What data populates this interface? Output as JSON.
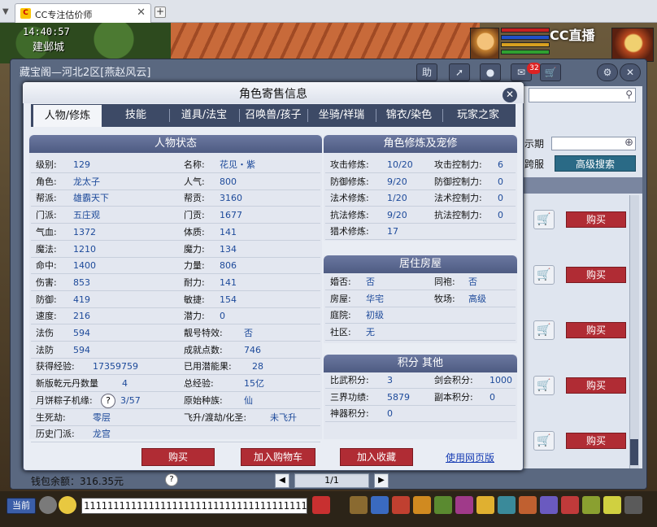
{
  "browser": {
    "tab_title": "CC专注估价师"
  },
  "game": {
    "clock": "14:40:57",
    "city": "建邺城",
    "logo": "CC直播",
    "chat_badge": "32"
  },
  "outer": {
    "title": "藏宝阁—河北2区[燕赵风云]",
    "expire_label": "示期",
    "cross_label": "跨服",
    "advanced_search": "高级搜索",
    "buy_label": "购买",
    "wallet": "钱包余额：316.35元",
    "page": "1/1"
  },
  "modal": {
    "title": "角色寄售信息",
    "tabs": [
      {
        "label": "人物/修炼"
      },
      {
        "label": "技能"
      },
      {
        "label": "道具/法宝"
      },
      {
        "label": "召唤兽/孩子"
      },
      {
        "label": "坐骑/祥瑞"
      },
      {
        "label": "锦衣/染色"
      },
      {
        "label": "玩家之家"
      }
    ],
    "status_title": "人物状态",
    "status_left": [
      {
        "k": "级别:",
        "v": "129"
      },
      {
        "k": "角色:",
        "v": "龙太子"
      },
      {
        "k": "帮派:",
        "v": "雄霸天下"
      },
      {
        "k": "门派:",
        "v": "五庄观"
      },
      {
        "k": "气血:",
        "v": "1372"
      },
      {
        "k": "魔法:",
        "v": "1210"
      },
      {
        "k": "命中:",
        "v": "1400"
      },
      {
        "k": "伤害:",
        "v": "853"
      },
      {
        "k": "防御:",
        "v": "419"
      },
      {
        "k": "速度:",
        "v": "216"
      },
      {
        "k": "法伤",
        "v": "594"
      },
      {
        "k": "法防",
        "v": "594"
      },
      {
        "k": "获得经验:",
        "v": "17359759"
      },
      {
        "k": "新版乾元丹数量",
        "v": "4"
      },
      {
        "k": "月饼粽子机缘:",
        "v": "3/57"
      },
      {
        "k": "生死劫:",
        "v": "零层"
      },
      {
        "k": "历史门派:",
        "v": "龙宫"
      }
    ],
    "status_right": [
      {
        "k": "名称:",
        "v": "花见・紫"
      },
      {
        "k": "人气:",
        "v": "800"
      },
      {
        "k": "帮贡:",
        "v": "3160"
      },
      {
        "k": "门贡:",
        "v": "1677"
      },
      {
        "k": "体质:",
        "v": "141"
      },
      {
        "k": "魔力:",
        "v": "134"
      },
      {
        "k": "力量:",
        "v": "806"
      },
      {
        "k": "耐力:",
        "v": "141"
      },
      {
        "k": "敏捷:",
        "v": "154"
      },
      {
        "k": "潜力:",
        "v": "0"
      },
      {
        "k": "靓号特效:",
        "v": "否"
      },
      {
        "k": "成就点数:",
        "v": "746"
      },
      {
        "k": "已用潜能果:",
        "v": "28"
      },
      {
        "k": "总经验:",
        "v": "15亿"
      },
      {
        "k": "原始种族:",
        "v": "仙"
      },
      {
        "k": "飞升/渡劫/化圣:",
        "v": "未飞升"
      }
    ],
    "cultivation_title": "角色修炼及宠修",
    "cultivation": [
      {
        "k1": "攻击修炼:",
        "v1": "10/20",
        "k2": "攻击控制力:",
        "v2": "6"
      },
      {
        "k1": "防御修炼:",
        "v1": "9/20",
        "k2": "防御控制力:",
        "v2": "0"
      },
      {
        "k1": "法术修炼:",
        "v1": "1/20",
        "k2": "法术控制力:",
        "v2": "0"
      },
      {
        "k1": "抗法修炼:",
        "v1": "9/20",
        "k2": "抗法控制力:",
        "v2": "0"
      },
      {
        "k1": "猎术修炼:",
        "v1": "17",
        "k2": "",
        "v2": ""
      }
    ],
    "house_title": "居住房屋",
    "house": [
      {
        "k1": "婚否:",
        "v1": "否",
        "k2": "同袍:",
        "v2": "否"
      },
      {
        "k1": "房屋:",
        "v1": "华宅",
        "k2": "牧场:",
        "v2": "高级"
      },
      {
        "k1": "庭院:",
        "v1": "初级",
        "k2": "",
        "v2": ""
      },
      {
        "k1": "社区:",
        "v1": "无",
        "k2": "",
        "v2": ""
      }
    ],
    "score_title": "积分 其他",
    "score": [
      {
        "k1": "比武积分:",
        "v1": "3",
        "k2": "剑会积分:",
        "v2": "1000"
      },
      {
        "k1": "三界功绩:",
        "v1": "5879",
        "k2": "副本积分:",
        "v2": "0"
      },
      {
        "k1": "神器积分:",
        "v1": "0",
        "k2": "",
        "v2": ""
      }
    ],
    "buy_button": "购买",
    "cart_button": "加入购物车",
    "fav_button": "加入收藏",
    "web_link": "使用网页版"
  },
  "taskbar": {
    "current_channel": "当前",
    "chat_text": "11111111111111111111111111111111111111"
  },
  "colors": {
    "accent": "#b02c34",
    "header": "#3d4a66",
    "value_text": "#1d4a9a"
  }
}
